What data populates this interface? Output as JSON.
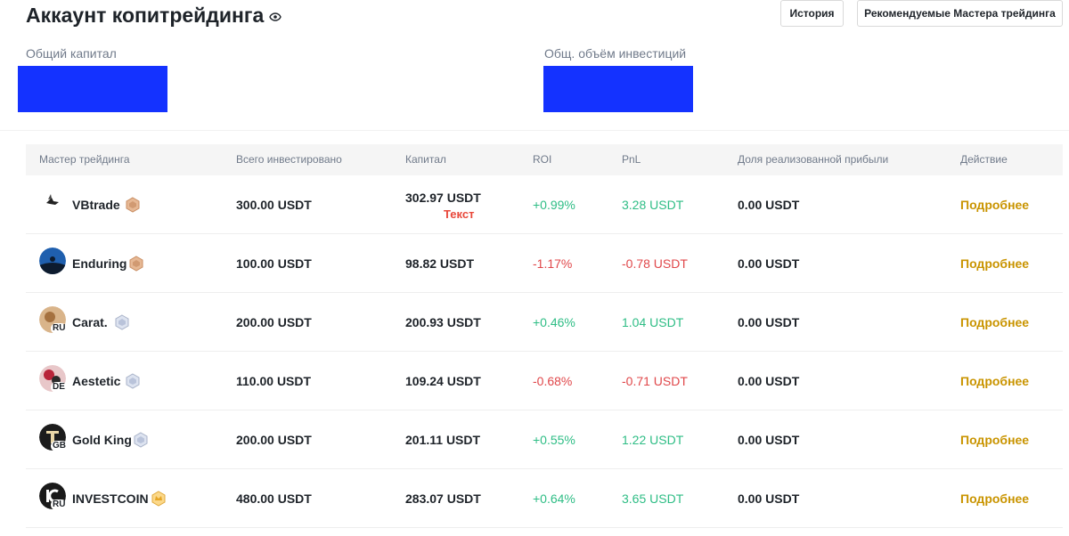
{
  "header": {
    "title": "Аккаунт копитрейдинга",
    "history_button": "История",
    "recommended_button": "Рекомендуемые Мастера трейдинга"
  },
  "stats": {
    "total_capital_label": "Общий капитал",
    "total_investment_label": "Общ. объём инвестиций"
  },
  "table": {
    "columns": [
      "Мастер трейдинга",
      "Всего инвестировано",
      "Капитал",
      "ROI",
      "PnL",
      "Доля реализованной прибыли",
      "Действие"
    ],
    "rows": [
      {
        "name": "VBtrade",
        "flag": "",
        "invested": "300.00 USDT",
        "capital": "302.97 USDT",
        "note": "Текст",
        "roi": "+0.99%",
        "pnl": "3.28 USDT",
        "share": "0.00 USDT",
        "action": "Подробнее",
        "badge": "bronze-badge-icon"
      },
      {
        "name": "Enduring",
        "flag": "",
        "invested": "100.00 USDT",
        "capital": "98.82 USDT",
        "note": "",
        "roi": "-1.17%",
        "pnl": "-0.78 USDT",
        "share": "0.00 USDT",
        "action": "Подробнее",
        "badge": "bronze-badge-icon"
      },
      {
        "name": "Carat.",
        "flag": "RU",
        "invested": "200.00 USDT",
        "capital": "200.93 USDT",
        "note": "",
        "roi": "+0.46%",
        "pnl": "1.04 USDT",
        "share": "0.00 USDT",
        "action": "Подробнее",
        "badge": "silver-badge-icon"
      },
      {
        "name": "Aestetic",
        "flag": "DE",
        "invested": "110.00 USDT",
        "capital": "109.24 USDT",
        "note": "",
        "roi": "-0.68%",
        "pnl": "-0.71 USDT",
        "share": "0.00 USDT",
        "action": "Подробнее",
        "badge": "silver-badge-icon"
      },
      {
        "name": "Gold King",
        "flag": "GB",
        "invested": "200.00 USDT",
        "capital": "201.11 USDT",
        "note": "",
        "roi": "+0.55%",
        "pnl": "1.22 USDT",
        "share": "0.00 USDT",
        "action": "Подробнее",
        "badge": "silver-badge-icon"
      },
      {
        "name": "INVESTCOIN",
        "flag": "RU",
        "invested": "480.00 USDT",
        "capital": "283.07 USDT",
        "note": "",
        "roi": "+0.64%",
        "pnl": "3.65 USDT",
        "share": "0.00 USDT",
        "action": "Подробнее",
        "badge": "gold-badge-icon"
      }
    ]
  },
  "colors": {
    "positive": "#2ebd85",
    "negative": "#e0474a",
    "action": "#c99400",
    "redacted_box": "#1432ff"
  }
}
